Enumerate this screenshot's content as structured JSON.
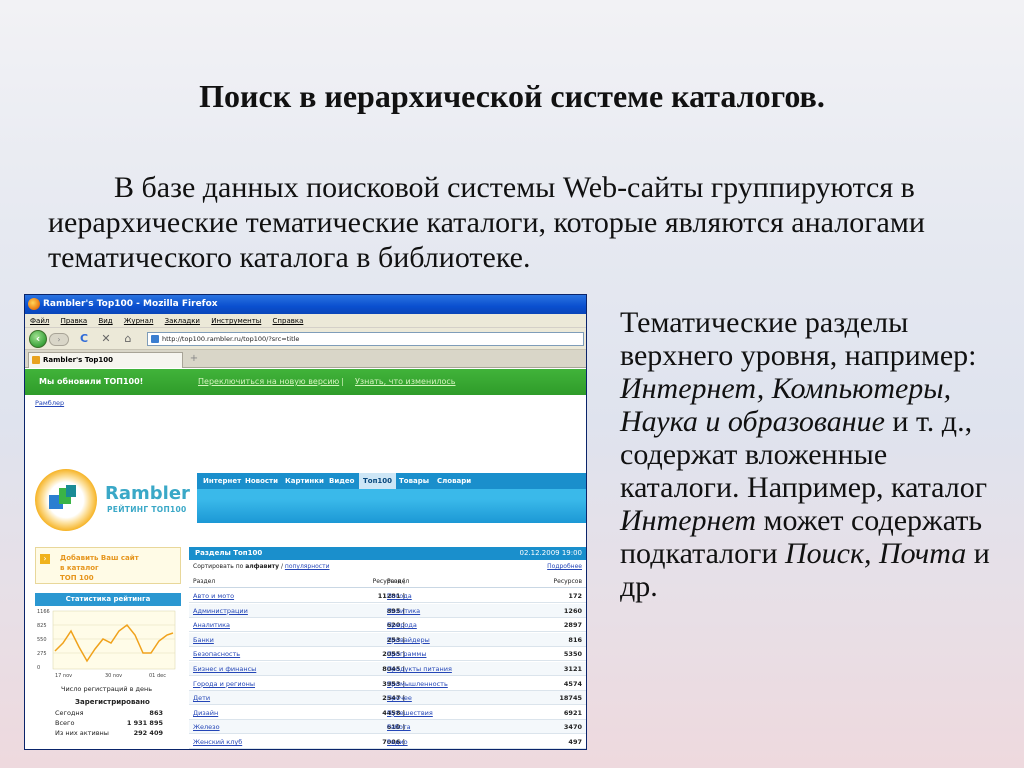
{
  "slide": {
    "title": "Поиск в иерархической системе каталогов.",
    "intro": "В базе данных поисковой системы Web-сайты группируются в иерархические тематические каталоги, которые являются аналогами тематического каталога в библиотеке.",
    "side_1": "Тематические разделы верхнего уровня, например: ",
    "side_italic_1": "Интернет, Компьютеры, Наука и образование",
    "side_2": " и т. д., содержат вложенные каталоги. Например, каталог ",
    "side_italic_2": "Интернет",
    "side_3": " может содержать подкаталоги ",
    "side_italic_3": "Поиск, Почта",
    "side_4": " и др."
  },
  "browser": {
    "title": "Rambler's Top100 - Mozilla Firefox",
    "menu": [
      "Файл",
      "Правка",
      "Вид",
      "Журнал",
      "Закладки",
      "Инструменты",
      "Справка"
    ],
    "url": "http://top100.rambler.ru/top100/?src=title",
    "tab_label": "Rambler's Top100",
    "new_tab": "+",
    "back_icon": "‹",
    "fwd_icon": "›",
    "reload_icon": "C",
    "stop_icon": "✕",
    "home_icon": "⌂"
  },
  "page": {
    "banner_title": "Мы обновили ТОП100!",
    "banner_link1": "Переключиться на новую версию",
    "banner_sep": "|",
    "banner_link2": "Узнать, что изменилось",
    "breadcrumb": "Рамблер",
    "logo_text": "Rambler",
    "logo_sub": "РЕЙТИНГ ТОП100",
    "nav": [
      "Интернет",
      "Новости",
      "Картинки",
      "Видео",
      "Топ100",
      "Товары",
      "Словари"
    ],
    "nav_active_index": 4,
    "add_site": [
      "Добавить Ваш сайт",
      "в каталог",
      "ТОП 100"
    ],
    "stats_header": "Статистика рейтинга",
    "chart_y_labels": [
      "1166",
      "825",
      "550",
      "275",
      "0"
    ],
    "chart_x_labels": [
      "17 nov",
      "30 nov",
      "01 dec"
    ],
    "chart_caption": "Число регистраций в день",
    "reg_header": "Зарегистрировано",
    "reg_rows": [
      {
        "label": "Сегодня",
        "value": "863"
      },
      {
        "label": "Всего",
        "value": "1 931 895"
      },
      {
        "label": "Из них активны",
        "value": "292 409"
      }
    ],
    "table_title": "Разделы Топ100",
    "table_date": "02.12.2009 19:00",
    "sort_prefix": "Сортировать по ",
    "sort_bold": "алфавиту",
    "sort_sep": " / ",
    "sort_link": "популярности",
    "sort_more": "Подробнее",
    "col_headers": [
      "Раздел",
      "Ресурсов |",
      "Раздел",
      "Ресурсов"
    ],
    "rows": [
      {
        "n1": "Авто и мото",
        "v1": "11281 |",
        "n2": "Погода",
        "v2": "172"
      },
      {
        "n1": "Администрации",
        "v1": "895 |",
        "n2": "Политика",
        "v2": "1260"
      },
      {
        "n1": "Аналитика",
        "v1": "620 |",
        "n2": "Природа",
        "v2": "2897"
      },
      {
        "n1": "Банки",
        "v1": "253 |",
        "n2": "Провайдеры",
        "v2": "816"
      },
      {
        "n1": "Безопасность",
        "v1": "2055 |",
        "n2": "Программы",
        "v2": "5350"
      },
      {
        "n1": "Бизнес и финансы",
        "v1": "8045 |",
        "n2": "Продукты питания",
        "v2": "3121"
      },
      {
        "n1": "Города и регионы",
        "v1": "3953 |",
        "n2": "Промышленность",
        "v2": "4574"
      },
      {
        "n1": "Дети",
        "v1": "2547 |",
        "n2": "Прочее",
        "v2": "18745"
      },
      {
        "n1": "Дизайн",
        "v1": "4458 |",
        "n2": "Путешествия",
        "v2": "6921"
      },
      {
        "n1": "Железо",
        "v1": "610 |",
        "n2": "Работа",
        "v2": "3470"
      },
      {
        "n1": "Женский клуб",
        "v1": "7006 |",
        "n2": "Радио",
        "v2": "497"
      }
    ]
  }
}
